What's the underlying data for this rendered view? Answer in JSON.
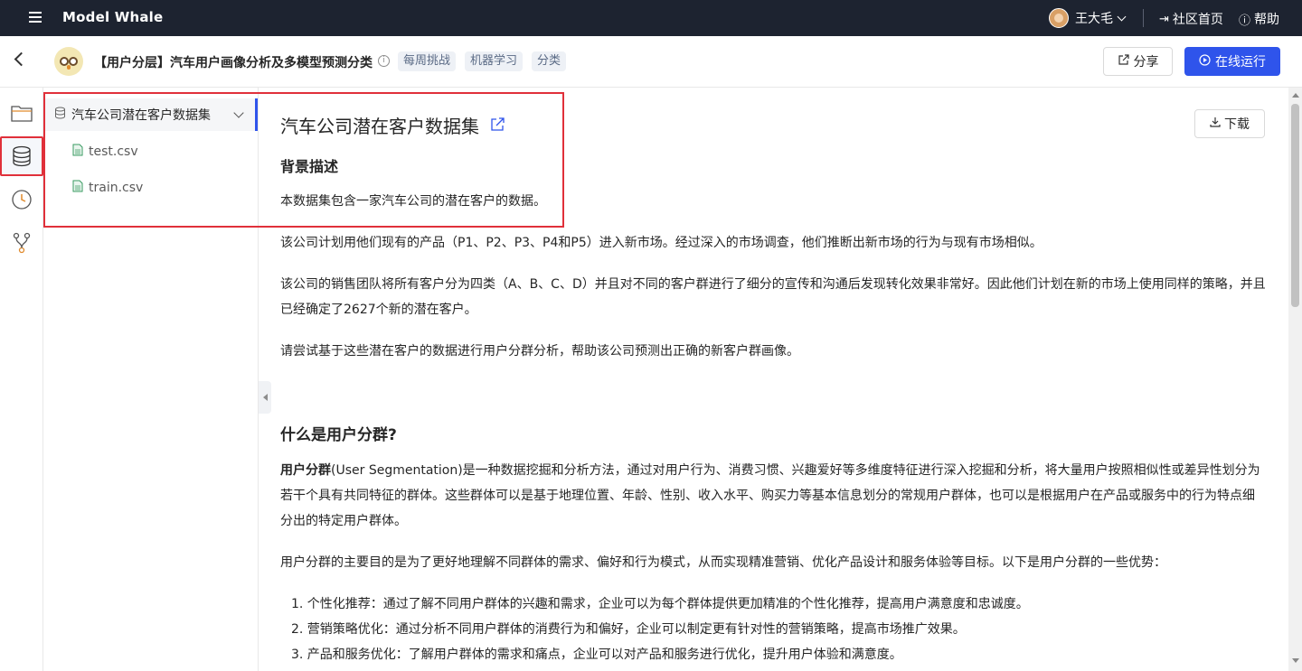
{
  "topbar": {
    "brand": "Model Whale",
    "user_name": "王大毛",
    "community_link": "社区首页",
    "help_link": "帮助"
  },
  "header": {
    "project_title": "【用户分层】汽车用户画像分析及多模型预测分类",
    "tags": [
      "每周挑战",
      "机器学习",
      "分类"
    ],
    "share_label": "分享",
    "run_label": "在线运行"
  },
  "filepanel": {
    "dataset_name": "汽车公司潜在客户数据集",
    "files": [
      "test.csv",
      "train.csv"
    ]
  },
  "main": {
    "dataset_title": "汽车公司潜在客户数据集",
    "download_label": "下载",
    "background_heading": "背景描述",
    "paragraphs": [
      "本数据集包含一家汽车公司的潜在客户的数据。",
      "该公司计划用他们现有的产品（P1、P2、P3、P4和P5）进入新市场。经过深入的市场调查，他们推断出新市场的行为与现有市场相似。",
      "该公司的销售团队将所有客户分为四类（A、B、C、D）并且对不同的客户群进行了细分的宣传和沟通后发现转化效果非常好。因此他们计划在新的市场上使用同样的策略，并且已经确定了2627个新的潜在客户。",
      "请尝试基于这些潜在客户的数据进行用户分群分析，帮助该公司预测出正确的新客户群画像。"
    ],
    "segmentation_heading": "什么是用户分群?",
    "seg_bold": "用户分群",
    "seg_text": "(User Segmentation)是一种数据挖掘和分析方法，通过对用户行为、消费习惯、兴趣爱好等多维度特征进行深入挖掘和分析，将大量用户按照相似性或差异性划分为若干个具有共同特征的群体。这些群体可以是基于地理位置、年龄、性别、收入水平、购买力等基本信息划分的常规用户群体，也可以是根据用户在产品或服务中的行为特点细分出的特定用户群体。",
    "purpose_text": "用户分群的主要目的是为了更好地理解不同群体的需求、偏好和行为模式，从而实现精准营销、优化产品设计和服务体验等目标。以下是用户分群的一些优势：",
    "advantages": [
      "1. 个性化推荐：通过了解不同用户群体的兴趣和需求，企业可以为每个群体提供更加精准的个性化推荐，提高用户满意度和忠诚度。",
      "2. 营销策略优化：通过分析不同用户群体的消费行为和偏好，企业可以制定更有针对性的营销策略，提高市场推广效果。",
      "3. 产品和服务优化：了解用户群体的需求和痛点，企业可以对产品和服务进行优化，提升用户体验和满意度。"
    ]
  },
  "colors": {
    "topbar_bg": "#1d2330",
    "primary": "#2f54eb",
    "highlight": "#e0303a"
  }
}
